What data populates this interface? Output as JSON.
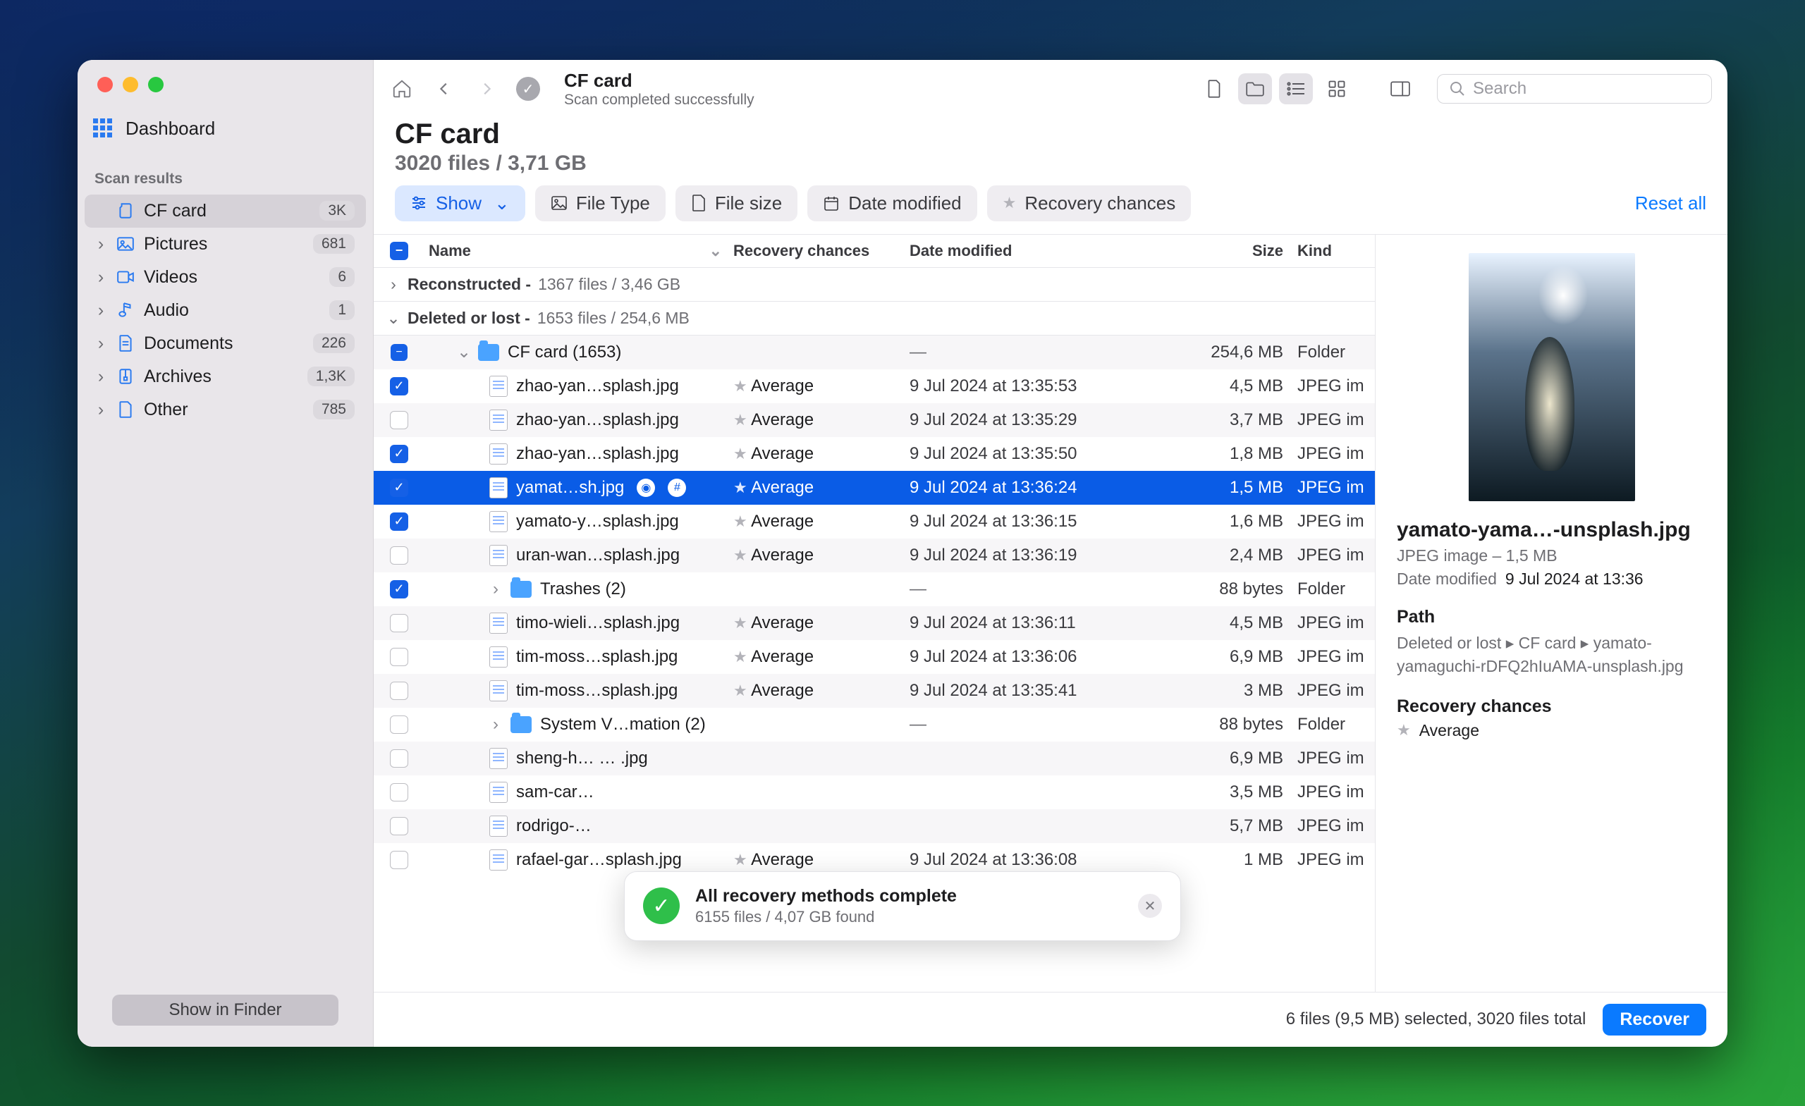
{
  "sidebar": {
    "dashboard_label": "Dashboard",
    "section_label": "Scan results",
    "items": [
      {
        "label": "CF card",
        "badge": "3K",
        "icon": "sd-card",
        "active": true,
        "chev": false
      },
      {
        "label": "Pictures",
        "badge": "681",
        "icon": "picture",
        "chev": true
      },
      {
        "label": "Videos",
        "badge": "6",
        "icon": "video",
        "chev": true
      },
      {
        "label": "Audio",
        "badge": "1",
        "icon": "audio",
        "chev": true
      },
      {
        "label": "Documents",
        "badge": "226",
        "icon": "document",
        "chev": true
      },
      {
        "label": "Archives",
        "badge": "1,3K",
        "icon": "archive",
        "chev": true
      },
      {
        "label": "Other",
        "badge": "785",
        "icon": "other",
        "chev": true
      }
    ],
    "footer_button": "Show in Finder"
  },
  "toolbar": {
    "title": "CF card",
    "subtitle": "Scan completed successfully",
    "search_placeholder": "Search"
  },
  "page_header": {
    "title": "CF card",
    "subtitle": "3020 files / 3,71 GB"
  },
  "filters": {
    "show_label": "Show",
    "file_type": "File Type",
    "file_size": "File size",
    "date_modified": "Date modified",
    "recovery_chances": "Recovery chances",
    "reset": "Reset all"
  },
  "columns": {
    "name": "Name",
    "recovery": "Recovery chances",
    "date": "Date modified",
    "size": "Size",
    "kind": "Kind"
  },
  "groups": [
    {
      "name": "Reconstructed",
      "meta": "1367 files / 3,46 GB",
      "expanded": false
    },
    {
      "name": "Deleted or lost",
      "meta": "1653 files / 254,6 MB",
      "expanded": true
    }
  ],
  "rows": [
    {
      "type": "folder",
      "indent": 1,
      "checked": true,
      "expanded": true,
      "name": "CF card (1653)",
      "date": "—",
      "size": "254,6 MB",
      "kind": "Folder"
    },
    {
      "type": "file",
      "indent": 2,
      "checked": true,
      "name": "zhao-yan…splash.jpg",
      "rec": "Average",
      "date": "9 Jul 2024 at 13:35:53",
      "size": "4,5 MB",
      "kind": "JPEG im"
    },
    {
      "type": "file",
      "indent": 2,
      "checked": false,
      "name": "zhao-yan…splash.jpg",
      "rec": "Average",
      "date": "9 Jul 2024 at 13:35:29",
      "size": "3,7 MB",
      "kind": "JPEG im"
    },
    {
      "type": "file",
      "indent": 2,
      "checked": true,
      "name": "zhao-yan…splash.jpg",
      "rec": "Average",
      "date": "9 Jul 2024 at 13:35:50",
      "size": "1,8 MB",
      "kind": "JPEG im"
    },
    {
      "type": "file",
      "indent": 2,
      "checked": true,
      "selected": true,
      "name": "yamat…sh.jpg",
      "rec": "Average",
      "date": "9 Jul 2024 at 13:36:24",
      "size": "1,5 MB",
      "kind": "JPEG im",
      "quick": true
    },
    {
      "type": "file",
      "indent": 2,
      "checked": true,
      "name": "yamato-y…splash.jpg",
      "rec": "Average",
      "date": "9 Jul 2024 at 13:36:15",
      "size": "1,6 MB",
      "kind": "JPEG im"
    },
    {
      "type": "file",
      "indent": 2,
      "checked": false,
      "name": "uran-wan…splash.jpg",
      "rec": "Average",
      "date": "9 Jul 2024 at 13:36:19",
      "size": "2,4 MB",
      "kind": "JPEG im"
    },
    {
      "type": "folder",
      "indent": 2,
      "checked": true,
      "chev": true,
      "name": "Trashes (2)",
      "date": "—",
      "size": "88 bytes",
      "kind": "Folder"
    },
    {
      "type": "file",
      "indent": 2,
      "checked": false,
      "name": "timo-wieli…splash.jpg",
      "rec": "Average",
      "date": "9 Jul 2024 at 13:36:11",
      "size": "4,5 MB",
      "kind": "JPEG im"
    },
    {
      "type": "file",
      "indent": 2,
      "checked": false,
      "name": "tim-moss…splash.jpg",
      "rec": "Average",
      "date": "9 Jul 2024 at 13:36:06",
      "size": "6,9 MB",
      "kind": "JPEG im"
    },
    {
      "type": "file",
      "indent": 2,
      "checked": false,
      "name": "tim-moss…splash.jpg",
      "rec": "Average",
      "date": "9 Jul 2024 at 13:35:41",
      "size": "3 MB",
      "kind": "JPEG im"
    },
    {
      "type": "folder",
      "indent": 2,
      "checked": false,
      "chev": true,
      "name": "System V…mation (2)",
      "date": "—",
      "size": "88 bytes",
      "kind": "Folder"
    },
    {
      "type": "file",
      "indent": 2,
      "checked": false,
      "name": "sheng-h…    …   .jpg",
      "rec": "",
      "date": "",
      "size": "6,9 MB",
      "kind": "JPEG im"
    },
    {
      "type": "file",
      "indent": 2,
      "checked": false,
      "name": "sam-car…            ",
      "rec": "",
      "date": "",
      "size": "3,5 MB",
      "kind": "JPEG im"
    },
    {
      "type": "file",
      "indent": 2,
      "checked": false,
      "name": "rodrigo-…            ",
      "rec": "",
      "date": "",
      "size": "5,7 MB",
      "kind": "JPEG im"
    },
    {
      "type": "file",
      "indent": 2,
      "checked": false,
      "name": "rafael-gar…splash.jpg",
      "rec": "Average",
      "date": "9 Jul 2024 at 13:36:08",
      "size": "1 MB",
      "kind": "JPEG im"
    }
  ],
  "preview": {
    "filename": "yamato-yama…-unsplash.jpg",
    "meta": "JPEG image – 1,5 MB",
    "date_label": "Date modified",
    "date_value": "9 Jul 2024 at 13:36",
    "path_label": "Path",
    "path_value": "Deleted or lost ▸ CF card ▸ yamato-yamaguchi-rDFQ2hIuAMA-unsplash.jpg",
    "rc_label": "Recovery chances",
    "rc_value": "Average"
  },
  "footer": {
    "status": "6 files (9,5 MB) selected, 3020 files total",
    "recover": "Recover"
  },
  "toast": {
    "title": "All recovery methods complete",
    "subtitle": "6155 files / 4,07 GB found"
  }
}
